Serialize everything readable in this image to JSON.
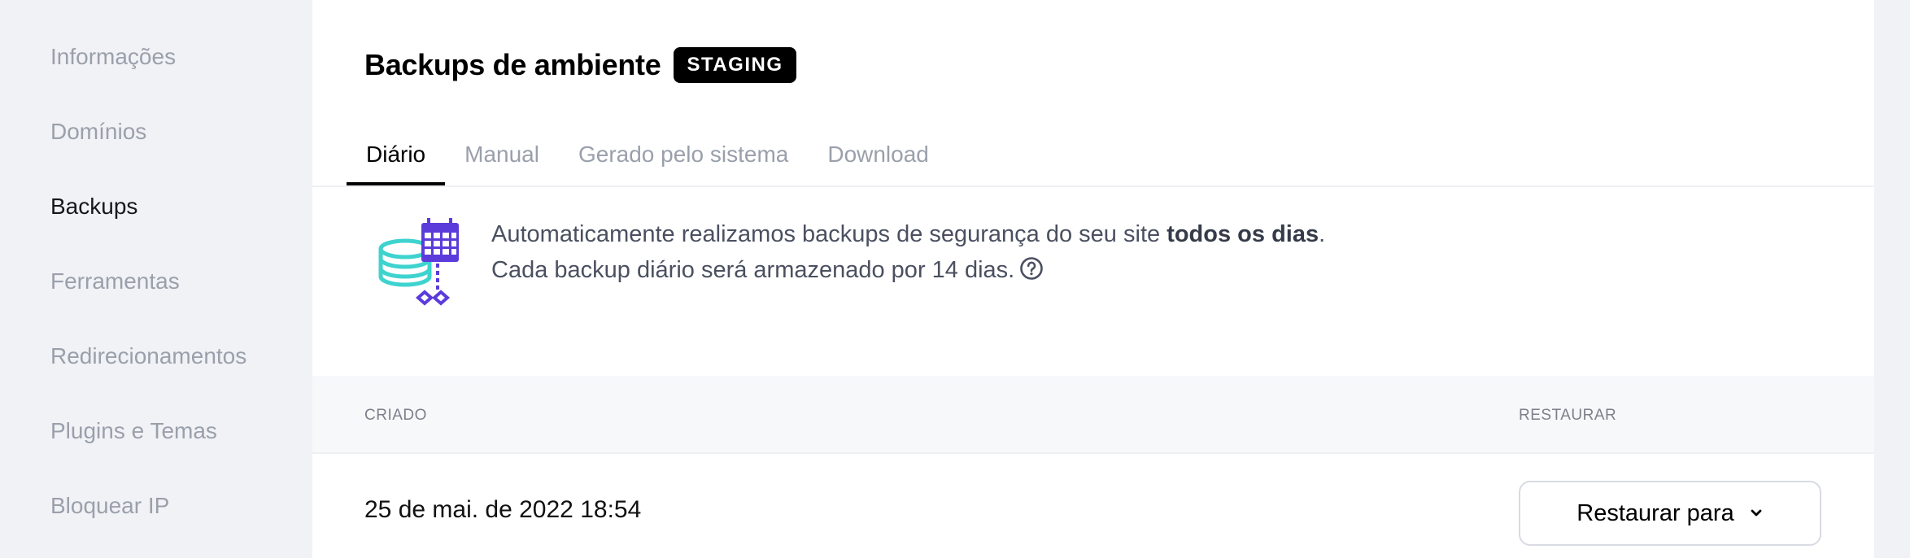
{
  "sidebar": {
    "items": [
      {
        "label": "Informações",
        "active": false
      },
      {
        "label": "Domínios",
        "active": false
      },
      {
        "label": "Backups",
        "active": true
      },
      {
        "label": "Ferramentas",
        "active": false
      },
      {
        "label": "Redirecionamentos",
        "active": false
      },
      {
        "label": "Plugins e Temas",
        "active": false
      },
      {
        "label": "Bloquear IP",
        "active": false
      }
    ]
  },
  "header": {
    "title": "Backups de ambiente",
    "env_badge": "STAGING"
  },
  "tabs": [
    {
      "label": "Diário",
      "active": true
    },
    {
      "label": "Manual",
      "active": false
    },
    {
      "label": "Gerado pelo sistema",
      "active": false
    },
    {
      "label": "Download",
      "active": false
    }
  ],
  "info": {
    "illustration_icon": "database-calendar-icon",
    "line1_prefix": "Automaticamente realizamos backups de segurança do seu site ",
    "line1_bold": "todos os dias",
    "line1_suffix": ".",
    "line2": "Cada backup diário será armazenado por 14 dias.",
    "help_icon": "question-circle-icon"
  },
  "table": {
    "columns": {
      "created": "CRIADO",
      "restore": "RESTAURAR"
    },
    "rows": [
      {
        "created": "25 de mai. de 2022 18:54",
        "restore_label": "Restaurar para"
      }
    ]
  },
  "colors": {
    "accent_purple": "#5b3cdb",
    "accent_teal": "#3ed3cf",
    "badge_bg": "#000000"
  }
}
